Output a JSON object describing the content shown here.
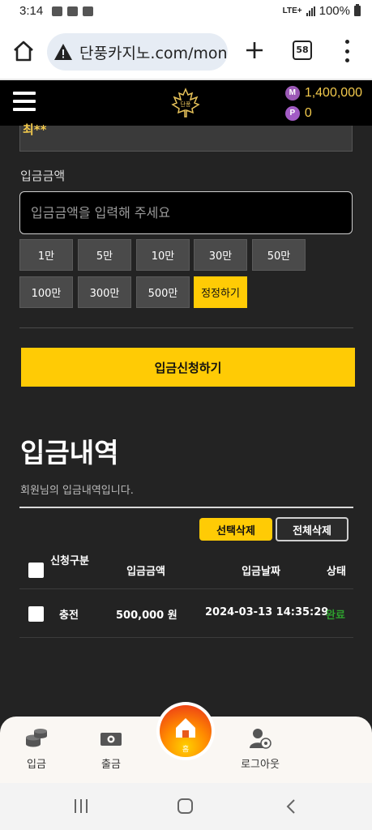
{
  "status_bar": {
    "time": "3:14",
    "network": "LTE+",
    "battery": "100%"
  },
  "browser": {
    "url": "단풍카지노.com/mone",
    "tab_count": "58"
  },
  "header": {
    "balance_money": "1,400,000",
    "balance_points": "0",
    "coin_m": "M",
    "coin_p": "P",
    "logo_text": "단풍"
  },
  "form": {
    "previous_value": "최**",
    "amount_label": "입금금액",
    "amount_placeholder": "입금금액을 입력해 주세요",
    "quick_buttons": [
      "1만",
      "5만",
      "10만",
      "30만",
      "50만",
      "100만",
      "300만",
      "500만",
      "정정하기"
    ],
    "submit_label": "입금신청하기"
  },
  "history": {
    "title": "입금내역",
    "description": "회원님의 입금내역입니다.",
    "delete_selected": "선택삭제",
    "delete_all": "전체삭제",
    "columns": [
      "신청구분",
      "입금금액",
      "입금날짜",
      "상태"
    ],
    "rows": [
      {
        "type": "충전",
        "amount": "500,000 원",
        "date": "2024-03-13 14:35:29",
        "status": "완료"
      }
    ]
  },
  "bottom_nav": {
    "deposit": "입금",
    "withdraw": "출금",
    "home": "홈",
    "logout": "로그아웃"
  },
  "colors": {
    "accent": "#ffcb05",
    "background": "#232323",
    "status_done": "#2ea02e",
    "balance": "#f2c94c"
  }
}
